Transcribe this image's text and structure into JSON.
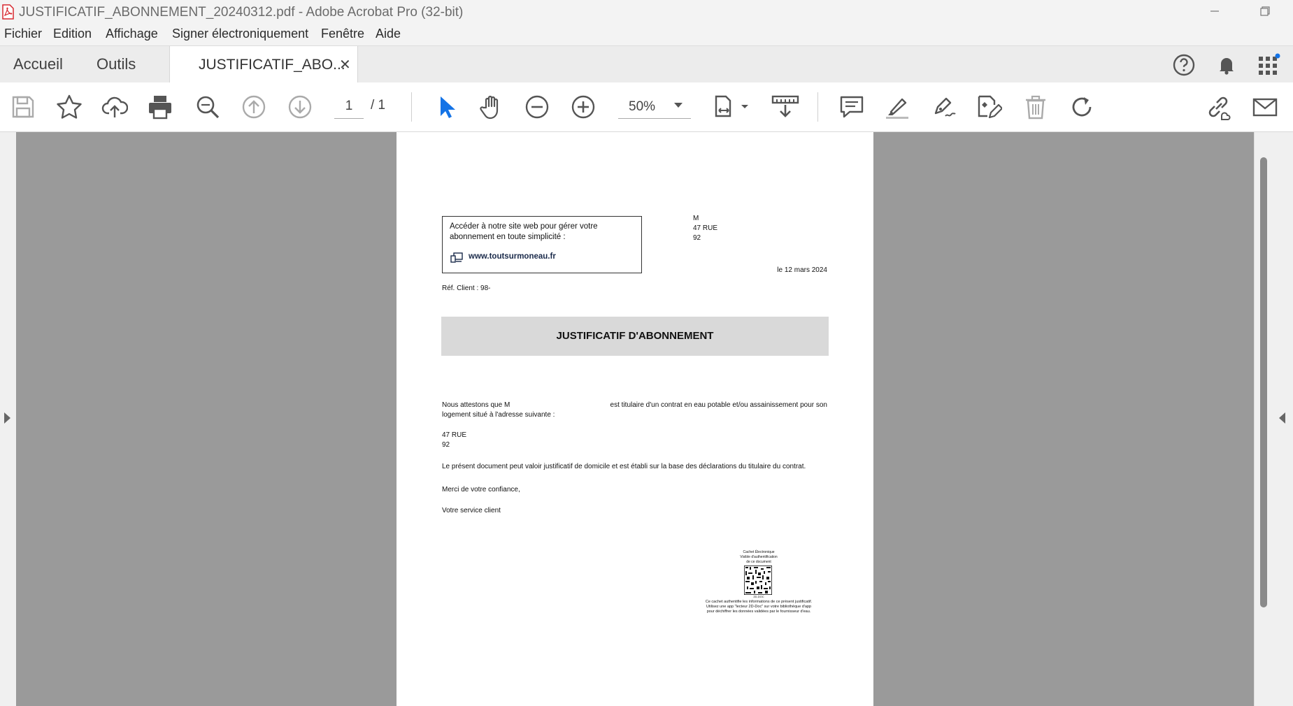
{
  "window": {
    "title": "JUSTIFICATIF_ABONNEMENT_20240312.pdf - Adobe Acrobat Pro (32-bit)"
  },
  "menu": [
    "Fichier",
    "Edition",
    "Affichage",
    "Signer électroniquement",
    "Fenêtre",
    "Aide"
  ],
  "tabs": {
    "home": "Accueil",
    "tools": "Outils",
    "document": "JUSTIFICATIF_ABO..."
  },
  "toolbar": {
    "current_page": "1",
    "total_pages": "/ 1",
    "zoom": "50%"
  },
  "document": {
    "web_box_text_1": "Accéder à notre site web pour gérer votre",
    "web_box_text_2": "abonnement en toute simplicité :",
    "website": "www.toutsurmoneau.fr",
    "recipient_name": "M",
    "recipient_street": "47 RUE",
    "recipient_city": "92",
    "date": "le 12 mars 2024",
    "client_ref": "Réf. Client : 98-",
    "heading": "JUSTIFICATIF D'ABONNEMENT",
    "body_line1_a": "Nous attestons que M",
    "body_line1_b": "est titulaire d'un contrat en eau potable et/ou assainissement pour son",
    "body_line2": "logement situé à l'adresse suivante :",
    "address_street": "47 RUE",
    "address_city": "92",
    "statement": "Le présent document peut valoir justificatif de domicile et est établi sur la base des déclarations du titulaire du contrat.",
    "thanks": "Merci de votre confiance,",
    "signature": "Votre service client",
    "stamp_title_1": "Cachet Électronique",
    "stamp_title_2": "Visible d'authentification",
    "stamp_title_3": "de ce document",
    "stamp_code": "2D-DOC",
    "stamp_note_1": "Ce cachet authentifie les informations de ce présent justificatif.",
    "stamp_note_2": "Utilisez une app \"lecteur 2D-Doc\" sur votre bibliothèque d'app",
    "stamp_note_3": "pour déchiffrer les données validées par le fournisseur d'eau."
  },
  "colors": {
    "accent_blue": "#1473e6",
    "acrobat_red": "#d7282f",
    "notification_dot": "#1473e6",
    "viewer_background": "#9a9a9a",
    "banner_gray": "#d9d9d9"
  }
}
